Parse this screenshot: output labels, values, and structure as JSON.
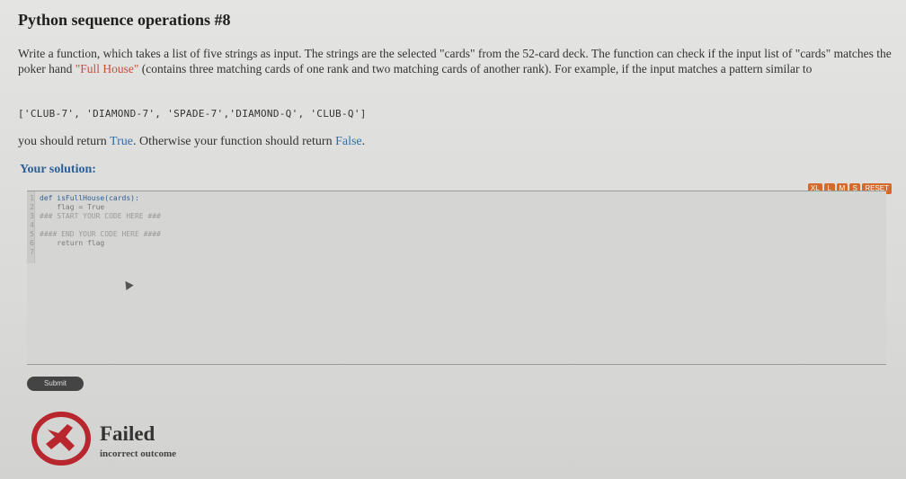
{
  "title": "Python sequence operations #8",
  "description": {
    "part1": "Write a function, which takes a list of five strings as input. The strings are the selected \"cards\" from the 52-card deck. The function can check if the input list of \"cards\" matches the poker hand ",
    "highlight": "\"Full House\"",
    "part2": " (contains three matching cards of one rank and two matching cards of another rank). For example, if the input matches a pattern similar to"
  },
  "example_code": "['CLUB-7',  'DIAMOND-7',  'SPADE-7','DIAMOND-Q',  'CLUB-Q']",
  "return_text": {
    "prefix": "you should return ",
    "true_word": "True",
    "middle": ". Otherwise your function should return ",
    "false_word": "False",
    "suffix": "."
  },
  "solution_label": "Your solution:",
  "size_buttons": [
    "XL",
    "L",
    "M",
    "S",
    "RESET"
  ],
  "editor": {
    "lines": [
      {
        "num": "1",
        "text": "def isFullHouse(cards):"
      },
      {
        "num": "2",
        "text": "    flag = True"
      },
      {
        "num": "3",
        "text": "### START YOUR CODE HERE ###"
      },
      {
        "num": "4",
        "text": ""
      },
      {
        "num": "5",
        "text": "#### END YOUR CODE HERE ####"
      },
      {
        "num": "6",
        "text": "    return flag"
      },
      {
        "num": "7",
        "text": ""
      }
    ]
  },
  "submit_label": "Submit",
  "result": {
    "title": "Failed",
    "subtitle": "incorrect outcome",
    "icon": "failed-icon",
    "color": "#b8262e"
  }
}
